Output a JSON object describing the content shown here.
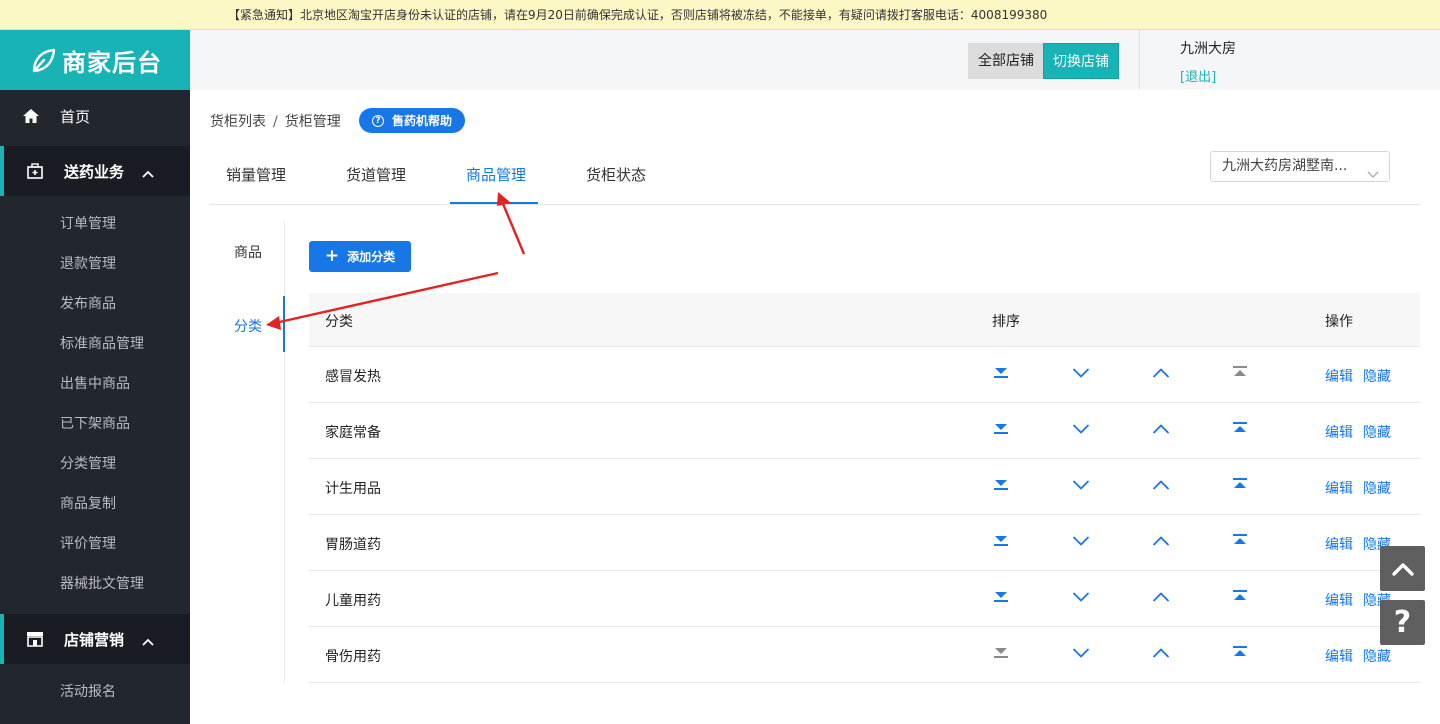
{
  "notice": "【紧急通知】北京地区淘宝开店身份未认证的店铺，请在9月20日前确保完成认证，否则店铺将被冻结，不能接单，有疑问请拨打客服电话：4008199380",
  "logo": {
    "text": "商家后台"
  },
  "topbar": {
    "all_stores": "全部店铺",
    "switch_store": "切换店铺",
    "shop_name": "九洲大房",
    "logout": "[退出]"
  },
  "sidebar": {
    "home": "首页",
    "groups": [
      {
        "label": "送药业务",
        "items": [
          "订单管理",
          "退款管理",
          "发布商品",
          "标准商品管理",
          "出售中商品",
          "已下架商品",
          "分类管理",
          "商品复制",
          "评价管理",
          "器械批文管理"
        ]
      },
      {
        "label": "店铺营销",
        "items": [
          "活动报名"
        ]
      }
    ]
  },
  "breadcrumb": {
    "items": [
      "货柜列表",
      "货柜管理"
    ],
    "help": "售药机帮助"
  },
  "tabs": [
    {
      "label": "销量管理",
      "active": false
    },
    {
      "label": "货道管理",
      "active": false
    },
    {
      "label": "商品管理",
      "active": true
    },
    {
      "label": "货柜状态",
      "active": false
    }
  ],
  "store_select": {
    "value": "九洲大药房湖墅南..."
  },
  "subnav": [
    {
      "label": "商品",
      "active": false
    },
    {
      "label": "分类",
      "active": true
    }
  ],
  "add_category": "添加分类",
  "table": {
    "headers": {
      "category": "分类",
      "sort": "排序",
      "actions": "操作"
    },
    "rows": [
      {
        "name": "感冒发热",
        "bottom_enabled": true,
        "top_enabled": false
      },
      {
        "name": "家庭常备",
        "bottom_enabled": true,
        "top_enabled": true
      },
      {
        "name": "计生用品",
        "bottom_enabled": true,
        "top_enabled": true
      },
      {
        "name": "胃肠道药",
        "bottom_enabled": true,
        "top_enabled": true
      },
      {
        "name": "儿童用药",
        "bottom_enabled": true,
        "top_enabled": true
      },
      {
        "name": "骨伤用药",
        "bottom_enabled": false,
        "top_enabled": true
      }
    ],
    "edit": "编辑",
    "hide": "隐藏"
  },
  "colors": {
    "accent": "#17b3b5",
    "primary": "#1777e6",
    "sidebar": "#22272e",
    "disabled": "#8a8a8a",
    "annotation": "#e32222"
  }
}
